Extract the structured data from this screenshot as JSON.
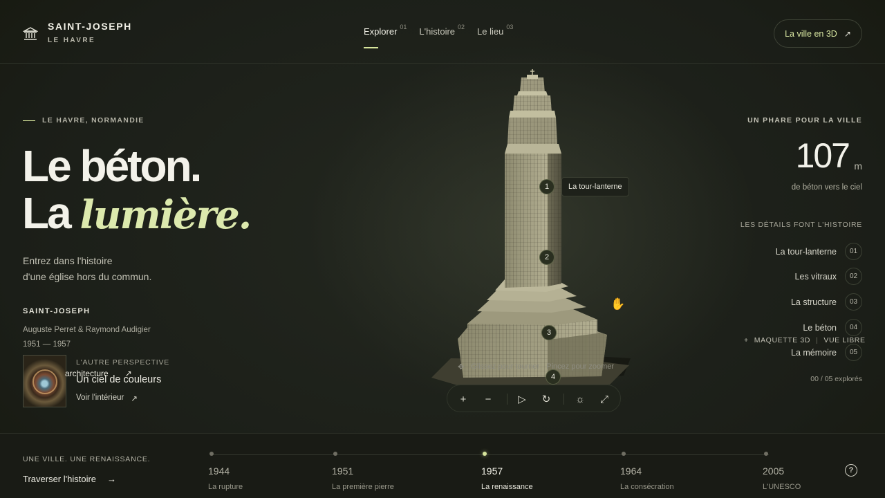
{
  "brand": {
    "title": "SAINT-JOSEPH",
    "subtitle": "LE HAVRE",
    "icon": "church-columns-icon"
  },
  "nav": {
    "items": [
      {
        "label": "Explorer",
        "num": "01",
        "active": true
      },
      {
        "label": "L'histoire",
        "num": "02"
      },
      {
        "label": "Le lieu",
        "num": "03"
      }
    ]
  },
  "cta": {
    "label": "La ville en 3D",
    "icon": "arrow-up-right-icon"
  },
  "hero": {
    "kicker": "LE HAVRE, NORMANDIE",
    "line1": "Le béton.",
    "line2_prefix": "La ",
    "line2_em": "lumière.",
    "intro1": "Entrez dans l'histoire",
    "intro2": "d'une église hors du commun."
  },
  "meta": {
    "title": "SAINT-JOSEPH",
    "architects": "Auguste Perret & Raymond Audigier",
    "years": "1951 — 1957"
  },
  "perspective": {
    "kicker": "L'AUTRE PERSPECTIVE",
    "tag": "architecture",
    "title": "Un ciel de couleurs",
    "link": "Voir l'intérieur"
  },
  "model": {
    "hotspots": [
      "1",
      "2",
      "3",
      "4"
    ],
    "tooltip": "La tour-lanterne",
    "hint_rotate": "Glissez pour tourner",
    "hint_zoom": "Pincez pour zoomer"
  },
  "toolbar": {
    "zoom_in": "+",
    "zoom_out": "−",
    "play": "▷",
    "reset": "↻",
    "light": "☼",
    "fullscreen": "⤢"
  },
  "stats": {
    "kicker": "UN PHARE POUR LA VILLE",
    "value": "107",
    "unit": "m",
    "caption": "de béton vers le ciel"
  },
  "details": {
    "title": "LES DÉTAILS FONT L'HISTOIRE",
    "items": [
      {
        "label": "La tour-lanterne",
        "num": "01"
      },
      {
        "label": "Les vitraux",
        "num": "02"
      },
      {
        "label": "La structure",
        "num": "03"
      },
      {
        "label": "Le béton",
        "num": "04"
      },
      {
        "label": "La mémoire",
        "num": "05"
      }
    ],
    "explored": "00 / 05 explorés"
  },
  "maquette": {
    "left": "MAQUETTE 3D",
    "right": "VUE LIBRE"
  },
  "footer": {
    "kicker": "UNE VILLE. UNE RENAISSANCE.",
    "link": "Traverser l'histoire",
    "timeline": [
      {
        "year": "1944",
        "label": "La rupture"
      },
      {
        "year": "1951",
        "label": "La première pierre"
      },
      {
        "year": "1957",
        "label": "La renaissance",
        "active": true
      },
      {
        "year": "1964",
        "label": "La consécration"
      },
      {
        "year": "2005",
        "label": "L'UNESCO"
      }
    ],
    "help": "?"
  },
  "colors": {
    "accent": "#d7e59c",
    "background": "#1b1e18",
    "concrete": "#a9a58a"
  }
}
